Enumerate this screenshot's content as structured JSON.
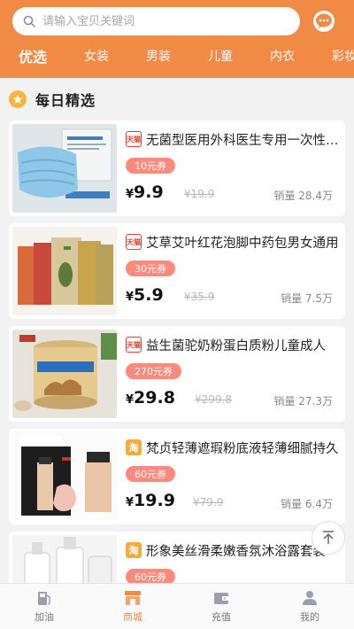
{
  "search": {
    "placeholder": "请输入宝贝关键词"
  },
  "tabs": [
    {
      "label": "优选",
      "active": true
    },
    {
      "label": "女装"
    },
    {
      "label": "男装"
    },
    {
      "label": "儿童"
    },
    {
      "label": "内衣"
    },
    {
      "label": "彩妆"
    }
  ],
  "section": {
    "title": "每日精选"
  },
  "products": [
    {
      "shop": "天猫",
      "shop_type": "tmall",
      "title": "无菌型医用外科医生专用一次性口罩",
      "coupon": "10元券",
      "price": "9.9",
      "original_price": "¥19.9",
      "sales": "销量 28.4万"
    },
    {
      "shop": "天猫",
      "shop_type": "tmall",
      "title": "艾草艾叶红花泡脚中药包男女通用",
      "coupon": "30元券",
      "price": "5.9",
      "original_price": "¥35.9",
      "sales": "销量 7.5万"
    },
    {
      "shop": "天猫",
      "shop_type": "tmall",
      "title": "益生菌驼奶粉蛋白质粉儿童成人",
      "coupon": "270元券",
      "price": "29.8",
      "original_price": "¥299.8",
      "sales": "销量 27.3万"
    },
    {
      "shop": "淘",
      "shop_type": "taobao",
      "title": "梵贞轻薄遮瑕粉底液轻薄细腻持久",
      "coupon": "60元券",
      "price": "19.9",
      "original_price": "¥79.9",
      "sales": "销量 6.4万"
    },
    {
      "shop": "淘",
      "shop_type": "taobao",
      "title": "形象美丝滑柔嫩香氛沐浴露套装",
      "coupon": "60元券",
      "price": "",
      "original_price": "",
      "sales": ""
    }
  ],
  "currency": "¥",
  "bottom_nav": [
    {
      "label": "加油",
      "icon": "fuel-icon"
    },
    {
      "label": "商城",
      "icon": "shop-icon",
      "active": true
    },
    {
      "label": "充值",
      "icon": "wallet-icon"
    },
    {
      "label": "我的",
      "icon": "user-icon"
    }
  ],
  "colors": {
    "accent": "#f08a45",
    "coupon": "#f98a7c",
    "tmall": "#e23a2e",
    "taobao": "#f7a93c"
  }
}
